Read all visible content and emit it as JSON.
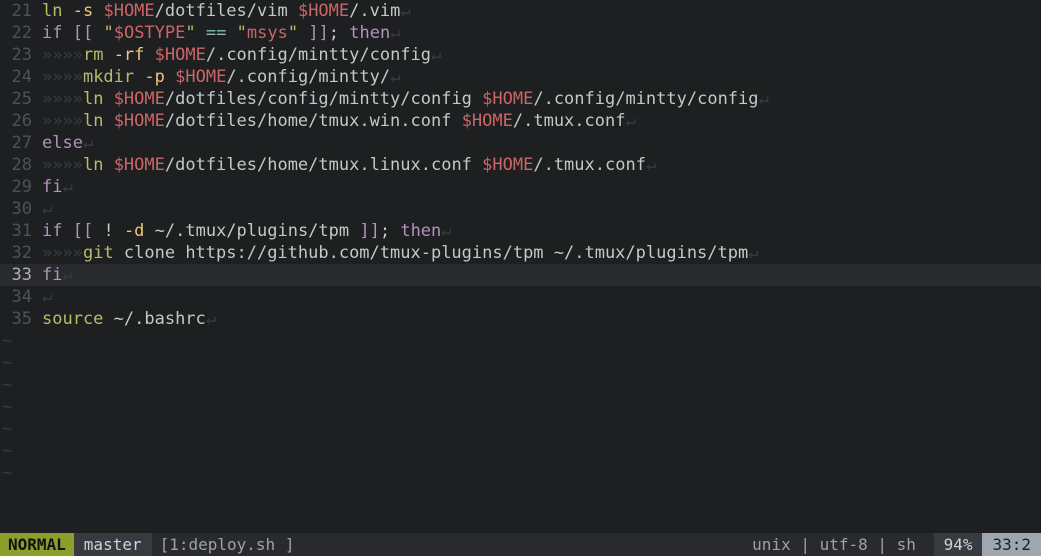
{
  "lines": [
    {
      "num": 21,
      "current": false,
      "tokens": [
        {
          "c": "cmd",
          "t": "ln"
        },
        {
          "c": "txt",
          "t": " "
        },
        {
          "c": "opt",
          "t": "-s"
        },
        {
          "c": "txt",
          "t": " "
        },
        {
          "c": "var",
          "t": "$HOME"
        },
        {
          "c": "txt",
          "t": "/dotfiles/vim "
        },
        {
          "c": "var",
          "t": "$HOME"
        },
        {
          "c": "txt",
          "t": "/.vim"
        },
        {
          "c": "ws",
          "t": "↵"
        }
      ]
    },
    {
      "num": 22,
      "current": false,
      "tokens": [
        {
          "c": "kw",
          "t": "if"
        },
        {
          "c": "txt",
          "t": " "
        },
        {
          "c": "kw",
          "t": "[["
        },
        {
          "c": "txt",
          "t": " "
        },
        {
          "c": "quote",
          "t": "\""
        },
        {
          "c": "var",
          "t": "$OSTYPE"
        },
        {
          "c": "quote",
          "t": "\""
        },
        {
          "c": "txt",
          "t": " "
        },
        {
          "c": "aqua",
          "t": "=="
        },
        {
          "c": "txt",
          "t": " "
        },
        {
          "c": "quote",
          "t": "\""
        },
        {
          "c": "str",
          "t": "msys"
        },
        {
          "c": "quote",
          "t": "\""
        },
        {
          "c": "txt",
          "t": " "
        },
        {
          "c": "kw",
          "t": "]]"
        },
        {
          "c": "txt",
          "t": "; "
        },
        {
          "c": "kw",
          "t": "then"
        },
        {
          "c": "ws",
          "t": "↵"
        }
      ]
    },
    {
      "num": 23,
      "current": false,
      "tokens": [
        {
          "c": "ws",
          "t": "»»»»"
        },
        {
          "c": "cmd",
          "t": "rm"
        },
        {
          "c": "txt",
          "t": " "
        },
        {
          "c": "opt",
          "t": "-rf"
        },
        {
          "c": "txt",
          "t": " "
        },
        {
          "c": "var",
          "t": "$HOME"
        },
        {
          "c": "txt",
          "t": "/.config/mintty/config"
        },
        {
          "c": "ws",
          "t": "↵"
        }
      ]
    },
    {
      "num": 24,
      "current": false,
      "tokens": [
        {
          "c": "ws",
          "t": "»»»»"
        },
        {
          "c": "cmd",
          "t": "mkdir"
        },
        {
          "c": "txt",
          "t": " "
        },
        {
          "c": "opt",
          "t": "-p"
        },
        {
          "c": "txt",
          "t": " "
        },
        {
          "c": "var",
          "t": "$HOME"
        },
        {
          "c": "txt",
          "t": "/.config/mintty/"
        },
        {
          "c": "ws",
          "t": "↵"
        }
      ]
    },
    {
      "num": 25,
      "current": false,
      "tokens": [
        {
          "c": "ws",
          "t": "»»»»"
        },
        {
          "c": "cmd",
          "t": "ln"
        },
        {
          "c": "txt",
          "t": " "
        },
        {
          "c": "var",
          "t": "$HOME"
        },
        {
          "c": "txt",
          "t": "/dotfiles/config/mintty/config "
        },
        {
          "c": "var",
          "t": "$HOME"
        },
        {
          "c": "txt",
          "t": "/.config/mintty/config"
        },
        {
          "c": "ws",
          "t": "↵"
        }
      ]
    },
    {
      "num": 26,
      "current": false,
      "tokens": [
        {
          "c": "ws",
          "t": "»»»»"
        },
        {
          "c": "cmd",
          "t": "ln"
        },
        {
          "c": "txt",
          "t": " "
        },
        {
          "c": "var",
          "t": "$HOME"
        },
        {
          "c": "txt",
          "t": "/dotfiles/home/tmux.win.conf "
        },
        {
          "c": "var",
          "t": "$HOME"
        },
        {
          "c": "txt",
          "t": "/.tmux.conf"
        },
        {
          "c": "ws",
          "t": "↵"
        }
      ]
    },
    {
      "num": 27,
      "current": false,
      "tokens": [
        {
          "c": "kw",
          "t": "else"
        },
        {
          "c": "ws",
          "t": "↵"
        }
      ]
    },
    {
      "num": 28,
      "current": false,
      "tokens": [
        {
          "c": "ws",
          "t": "»»»»"
        },
        {
          "c": "cmd",
          "t": "ln"
        },
        {
          "c": "txt",
          "t": " "
        },
        {
          "c": "var",
          "t": "$HOME"
        },
        {
          "c": "txt",
          "t": "/dotfiles/home/tmux.linux.conf "
        },
        {
          "c": "var",
          "t": "$HOME"
        },
        {
          "c": "txt",
          "t": "/.tmux.conf"
        },
        {
          "c": "ws",
          "t": "↵"
        }
      ]
    },
    {
      "num": 29,
      "current": false,
      "tokens": [
        {
          "c": "kw",
          "t": "fi"
        },
        {
          "c": "ws",
          "t": "↵"
        }
      ]
    },
    {
      "num": 30,
      "current": false,
      "tokens": [
        {
          "c": "ws",
          "t": "↵"
        }
      ]
    },
    {
      "num": 31,
      "current": false,
      "tokens": [
        {
          "c": "kw",
          "t": "if"
        },
        {
          "c": "txt",
          "t": " "
        },
        {
          "c": "kw",
          "t": "[["
        },
        {
          "c": "txt",
          "t": " ! "
        },
        {
          "c": "opt",
          "t": "-d"
        },
        {
          "c": "txt",
          "t": " ~/.tmux/plugins/tpm "
        },
        {
          "c": "kw",
          "t": "]]"
        },
        {
          "c": "txt",
          "t": "; "
        },
        {
          "c": "kw",
          "t": "then"
        },
        {
          "c": "ws",
          "t": "↵"
        }
      ]
    },
    {
      "num": 32,
      "current": false,
      "tokens": [
        {
          "c": "ws",
          "t": "»»»»"
        },
        {
          "c": "cmd",
          "t": "git"
        },
        {
          "c": "txt",
          "t": " clone https://github.com/tmux-plugins/tpm ~/.tmux/plugins/tpm"
        },
        {
          "c": "ws",
          "t": "↵"
        }
      ]
    },
    {
      "num": 33,
      "current": true,
      "tokens": [
        {
          "c": "kw",
          "t": "f"
        },
        {
          "c": "kw",
          "t": "i"
        },
        {
          "c": "ws",
          "t": "↵"
        }
      ]
    },
    {
      "num": 34,
      "current": false,
      "tokens": [
        {
          "c": "ws",
          "t": "↵"
        }
      ]
    },
    {
      "num": 35,
      "current": false,
      "tokens": [
        {
          "c": "cmd",
          "t": "source"
        },
        {
          "c": "txt",
          "t": " ~/.bashrc"
        },
        {
          "c": "ws",
          "t": "↵"
        }
      ]
    }
  ],
  "empty_tilde_rows": 7,
  "tilde_char": "~",
  "status": {
    "mode": "NORMAL",
    "branch": "master",
    "file": "[1:deploy.sh ]",
    "encoding": "unix | utf-8 | sh ",
    "percent": "94%",
    "position": "33:2"
  }
}
